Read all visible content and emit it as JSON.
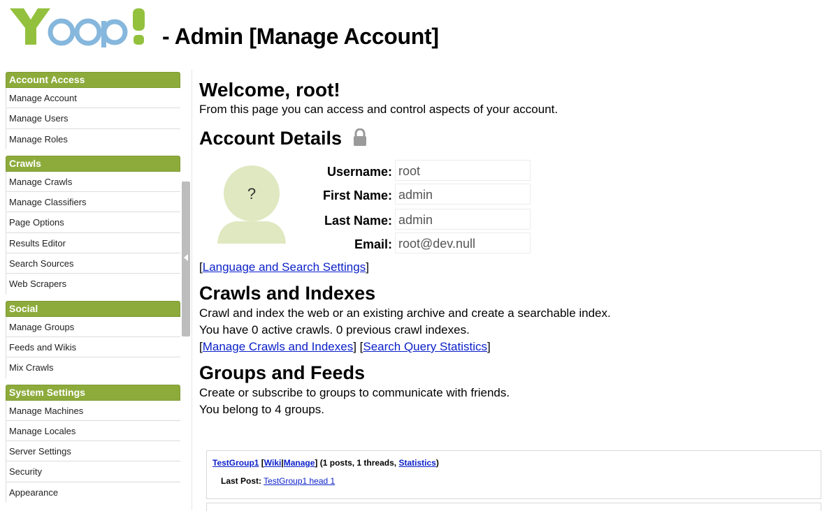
{
  "header": {
    "title": "- Admin [Manage Account]",
    "logo_text": "Yoop!"
  },
  "sidebar": {
    "groups": [
      {
        "title": "Account Access",
        "items": [
          "Manage Account",
          "Manage Users",
          "Manage Roles"
        ]
      },
      {
        "title": "Crawls",
        "items": [
          "Manage Crawls",
          "Manage Classifiers",
          "Page Options",
          "Results Editor",
          "Search Sources",
          "Web Scrapers"
        ]
      },
      {
        "title": "Social",
        "items": [
          "Manage Groups",
          "Feeds and Wikis",
          "Mix Crawls"
        ]
      },
      {
        "title": "System Settings",
        "items": [
          "Manage Machines",
          "Manage Locales",
          "Server Settings",
          "Security",
          "Appearance"
        ]
      }
    ]
  },
  "main": {
    "welcome": "Welcome, root!",
    "intro": "From this page you can access and control aspects of your account.",
    "account_details": {
      "title": "Account Details",
      "avatar_placeholder": "?",
      "fields": [
        {
          "label": "Username:",
          "value": "root"
        },
        {
          "label": "First Name:",
          "value": "admin"
        },
        {
          "label": "Last Name:",
          "value": "admin"
        },
        {
          "label": "Email:",
          "value": "root@dev.null"
        }
      ],
      "settings_link": "Language and Search Settings"
    },
    "crawls": {
      "title": "Crawls and Indexes",
      "desc": "Crawl and index the web or an existing archive and create a searchable index.",
      "status": "You have 0 active crawls. 0 previous crawl indexes.",
      "link_manage": "Manage Crawls and Indexes",
      "link_stats": "Search Query Statistics"
    },
    "groups": {
      "title": "Groups and Feeds",
      "desc": "Create or subscribe to groups to communicate with friends.",
      "status": "You belong to 4 groups.",
      "entry": {
        "name": "TestGroup1",
        "wiki": "Wiki",
        "manage": "Manage",
        "counts": "(1 posts, 1 threads,",
        "statistics": "Statistics",
        "last_post_label": "Last Post:",
        "last_post_link": "TestGroup1 head 1"
      }
    }
  },
  "colors": {
    "sidebar_header": "#8dab3b",
    "link": "#0a1fc8",
    "logo_green": "#8cbf3f",
    "logo_blue": "#7fb0d8"
  }
}
